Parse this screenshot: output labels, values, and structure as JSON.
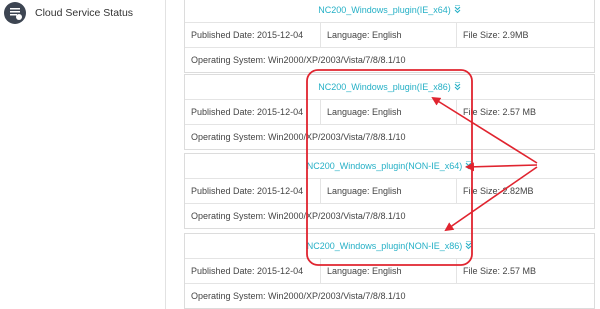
{
  "sidebar": {
    "item": {
      "label": "Cloud Service Status",
      "icon": "cloud-status-icon"
    }
  },
  "downloads": [
    {
      "name": "NC200_Windows_plugin(IE_x64)",
      "published": "Published Date: 2015-12-04",
      "language": "Language: English",
      "size": "File Size: 2.9MB",
      "os": "Operating System: Win2000/XP/2003/Vista/7/8/8.1/10"
    },
    {
      "name": "NC200_Windows_plugin(IE_x86)",
      "published": "Published Date: 2015-12-04",
      "language": "Language: English",
      "size": "File Size: 2.57 MB",
      "os": "Operating System: Win2000/XP/2003/Vista/7/8/8.1/10"
    },
    {
      "name": "NC200_Windows_plugin(NON-IE_x64)",
      "published": "Published Date: 2015-12-04",
      "language": "Language: English",
      "size": "File Size: 2.82MB",
      "os": "Operating System: Win2000/XP/2003/Vista/7/8/8.1/10"
    },
    {
      "name": "NC200_Windows_plugin(NON-IE_x86)",
      "published": "Published Date: 2015-12-04",
      "language": "Language: English",
      "size": "File Size: 2.57 MB",
      "os": "Operating System: Win2000/XP/2003/Vista/7/8/8.1/10"
    }
  ],
  "colors": {
    "link": "#25b0c6",
    "annotation": "#e0242f",
    "sidebar_icon_bg": "#3d4552"
  },
  "icons": {
    "download": "download-icon"
  }
}
